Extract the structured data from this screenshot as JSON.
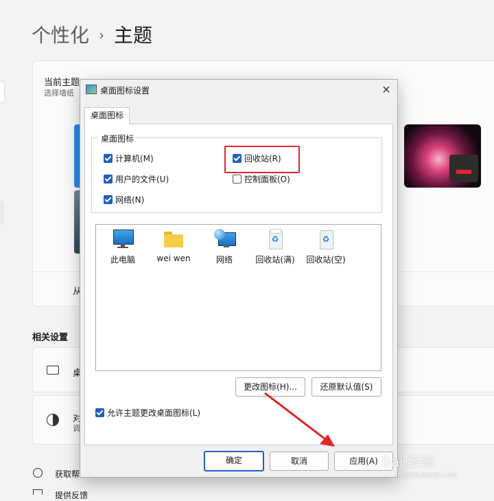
{
  "breadcrumb": {
    "parent": "个性化",
    "separator": "›",
    "current": "主题"
  },
  "current_theme": {
    "title": "当前主题",
    "subtitle": "选择墙纸"
  },
  "background_fragments": {
    "from_prefix": "从",
    "related_settings": "相关设置",
    "desktop_prefix": "桌",
    "contrast_prefix": "对",
    "contrast_sub": "调",
    "help_link": "获取帮",
    "feedback_link": "提供反馈"
  },
  "dialog": {
    "title": "桌面图标设置",
    "tab": "桌面图标",
    "group_label": "桌面图标",
    "checkboxes": [
      {
        "label": "计算机(M)",
        "checked": true
      },
      {
        "label": "回收站(R)",
        "checked": true
      },
      {
        "label": "用户的文件(U)",
        "checked": true
      },
      {
        "label": "控制面板(O)",
        "checked": false
      },
      {
        "label": "网络(N)",
        "checked": true
      }
    ],
    "icons": [
      {
        "label": "此电脑",
        "icon": "monitor-icon"
      },
      {
        "label": "wei wen",
        "icon": "folder-icon"
      },
      {
        "label": "网络",
        "icon": "network-globe-icon"
      },
      {
        "label": "回收站(满)",
        "icon": "recycle-bin-full-icon"
      },
      {
        "label": "回收站(空)",
        "icon": "recycle-bin-empty-icon"
      }
    ],
    "change_icon_button": "更改图标(H)...",
    "restore_default_button": "还原默认值(S)",
    "allow_themes_checkbox": {
      "label": "允许主题更改桌面图标(L)",
      "checked": true
    },
    "ok_button": "确定",
    "cancel_button": "取消",
    "apply_button": "应用(A)"
  },
  "watermark": {
    "brand": "Bai 经验",
    "url": "jingyan.baidu.com"
  },
  "colors": {
    "accent": "#1f5fbf",
    "highlight": "#e0252b",
    "bg": "#f3f3f3"
  }
}
